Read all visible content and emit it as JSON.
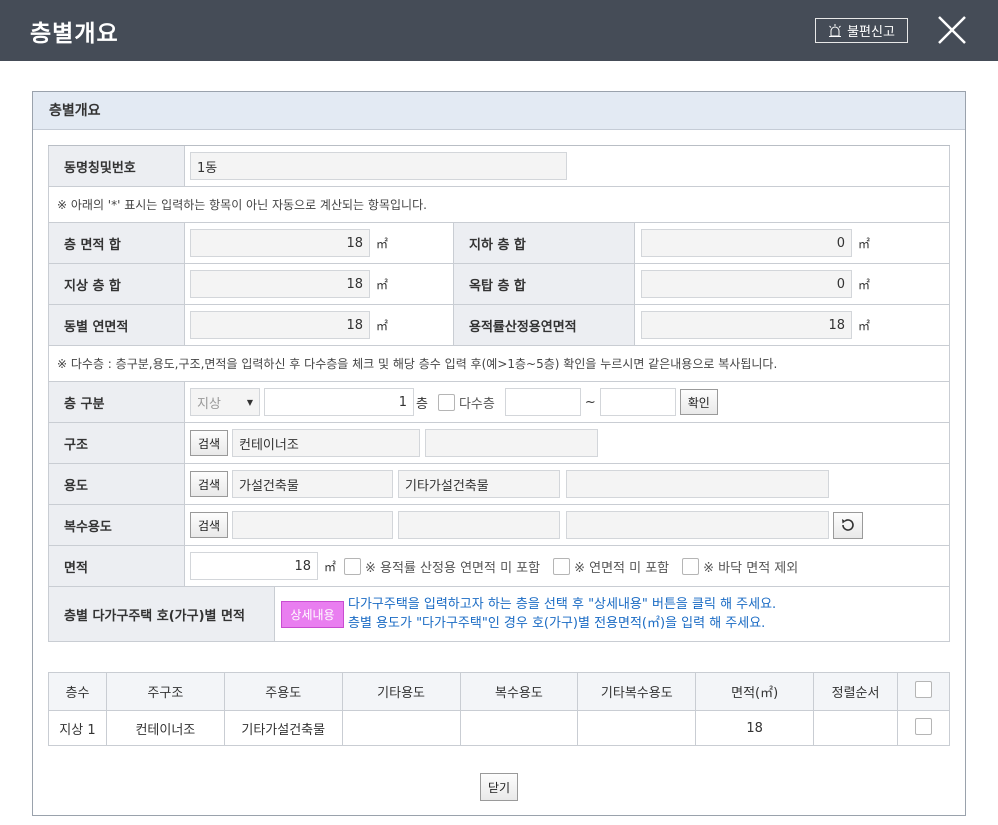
{
  "window": {
    "title": "층별개요",
    "report_label": "불편신고"
  },
  "panel": {
    "title": "층별개요"
  },
  "building": {
    "label": "동명칭및번호",
    "value": "1동"
  },
  "auto_note": "※ 아래의 '*' 표시는 입력하는 항목이 아닌 자동으로 계산되는 항목입니다.",
  "sums": {
    "floor_area_label": "층 면적 합",
    "floor_area_value": "18",
    "basement_label": "지하 층 합",
    "basement_value": "0",
    "above_label": "지상 층 합",
    "above_value": "18",
    "roof_label": "옥탑 층 합",
    "roof_value": "0",
    "total_label": "동별 연면적",
    "total_value": "18",
    "far_label": "용적률산정용연면적",
    "far_value": "18",
    "unit": "㎡"
  },
  "multi_note": "※ 다수층 : 층구분,용도,구조,면적을 입력하신 후 다수층을 체크 및 해당 층수 입력 후(예>1층~5층) 확인을 누르시면 같은내용으로 복사됩니다.",
  "floor": {
    "label": "층 구분",
    "type_value": "지상",
    "number_value": "1",
    "floor_suffix": "층",
    "multi_label": "다수층",
    "tilde": "~",
    "confirm_label": "확인"
  },
  "structure": {
    "label": "구조",
    "search_label": "검색",
    "value": "컨테이너조"
  },
  "usage": {
    "label": "용도",
    "search_label": "검색",
    "main": "가설건축물",
    "sub": "기타가설건축물"
  },
  "multi_usage": {
    "label": "복수용도",
    "search_label": "검색"
  },
  "area": {
    "label": "면적",
    "value": "18",
    "unit": "㎡",
    "opt1": "※ 용적률 산정용 연면적 미 포함",
    "opt2": "※ 연면적 미 포함",
    "opt3": "※ 바닥 면적 제외"
  },
  "household": {
    "label": "층별 다가구주택 호(가구)별 면적",
    "detail_label": "상세내용",
    "info1": "다가구주택을 입력하고자 하는 층을 선택 후 \"상세내용\" 버튼을 클릭 해 주세요.",
    "info2": "층별 용도가 \"다가구주택\"인 경우 호(가구)별 전용면적(㎡)을 입력 해 주세요."
  },
  "table": {
    "headers": [
      "층수",
      "주구조",
      "주용도",
      "기타용도",
      "복수용도",
      "기타복수용도",
      "면적(㎡)",
      "정렬순서"
    ],
    "rows": [
      {
        "floor": "지상 1",
        "structure": "컨테이너조",
        "usage": "기타가설건축물",
        "etc_usage": "",
        "multi": "",
        "etc_multi": "",
        "area": "18",
        "order": ""
      }
    ]
  },
  "footer": {
    "close_label": "닫기"
  }
}
